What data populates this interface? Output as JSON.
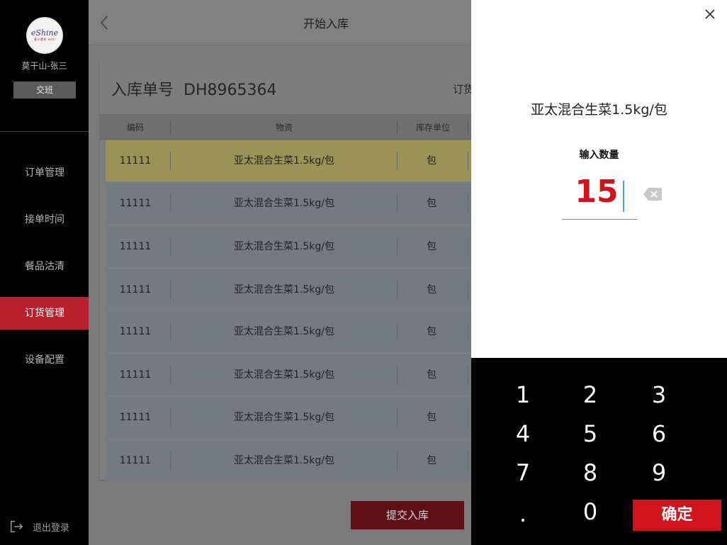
{
  "sidebar": {
    "logo": {
      "brand": "eShine",
      "sub": "意小就余 eshi"
    },
    "user_name": "莫干山-张三",
    "shift_label": "交班",
    "items": [
      {
        "label": "订单管理",
        "active": false
      },
      {
        "label": "接单时间",
        "active": false
      },
      {
        "label": "餐品沽清",
        "active": false
      },
      {
        "label": "订货管理",
        "active": true
      },
      {
        "label": "设备配置",
        "active": false
      }
    ],
    "logout_label": "退出登录"
  },
  "header": {
    "title": "开始入库",
    "back_icon": "chevron-left-icon"
  },
  "order": {
    "label": "入库单号",
    "number": "DH8965364",
    "extra_label": "订货"
  },
  "table": {
    "columns": [
      "编码",
      "物资",
      "库存单位"
    ],
    "rows": [
      {
        "code": "11111",
        "name": "亚太混合生菜1.5kg/包",
        "unit": "包",
        "highlighted": true
      },
      {
        "code": "11111",
        "name": "亚太混合生菜1.5kg/包",
        "unit": "包",
        "highlighted": false
      },
      {
        "code": "11111",
        "name": "亚太混合生菜1.5kg/包",
        "unit": "包",
        "highlighted": false
      },
      {
        "code": "11111",
        "name": "亚太混合生菜1.5kg/包",
        "unit": "包",
        "highlighted": false
      },
      {
        "code": "11111",
        "name": "亚太混合生菜1.5kg/包",
        "unit": "包",
        "highlighted": false
      },
      {
        "code": "11111",
        "name": "亚太混合生菜1.5kg/包",
        "unit": "包",
        "highlighted": false
      },
      {
        "code": "11111",
        "name": "亚太混合生菜1.5kg/包",
        "unit": "包",
        "highlighted": false
      },
      {
        "code": "11111",
        "name": "亚太混合生菜1.5kg/包",
        "unit": "包",
        "highlighted": false
      }
    ]
  },
  "submit_label": "提交入库",
  "panel": {
    "item_name": "亚太混合生菜1.5kg/包",
    "qty_label": "输入数量",
    "qty_value": "15",
    "close_icon": "close-icon",
    "backspace_icon": "backspace-icon"
  },
  "keypad": {
    "keys": [
      "1",
      "2",
      "3",
      "4",
      "5",
      "6",
      "7",
      "8",
      "9",
      ".",
      "0"
    ],
    "confirm_label": "确定"
  },
  "colors": {
    "accent": "#d0141d",
    "sidebar_active": "#b8202e",
    "caret": "#4aa3df"
  }
}
